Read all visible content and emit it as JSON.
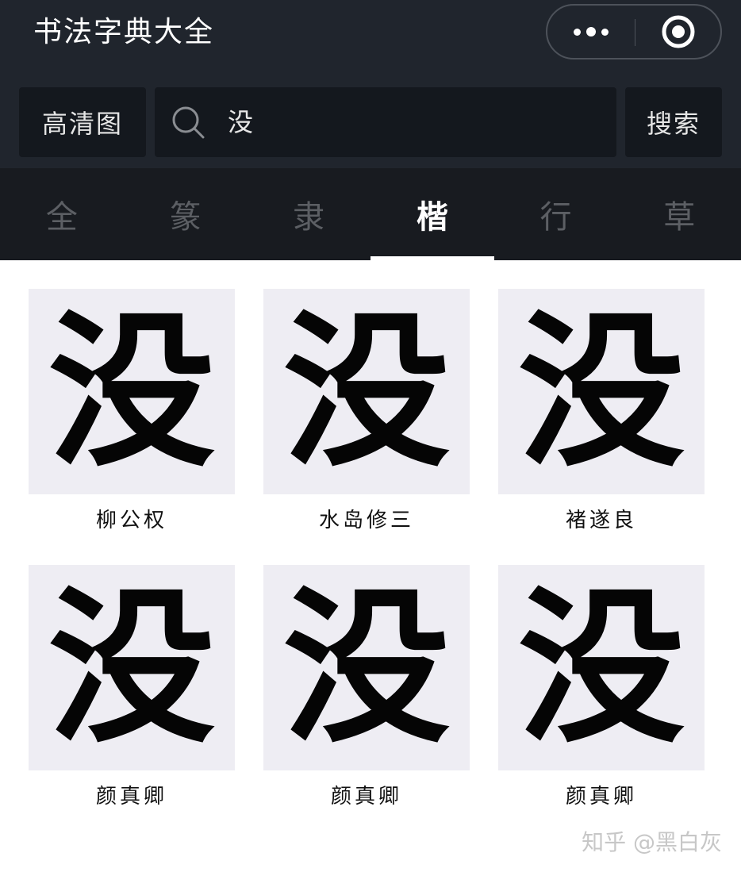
{
  "app": {
    "title": "书法字典大全"
  },
  "capsule": {
    "more_icon": "more-dots-icon",
    "close_icon": "target-close-icon"
  },
  "toolbar": {
    "hd_label": "高清图",
    "search_value": "没",
    "search_icon": "search-icon",
    "search_label": "搜索"
  },
  "tabs": [
    {
      "label": "全",
      "active": false
    },
    {
      "label": "篆",
      "active": false
    },
    {
      "label": "隶",
      "active": false
    },
    {
      "label": "楷",
      "active": true
    },
    {
      "label": "行",
      "active": false
    },
    {
      "label": "草",
      "active": false
    }
  ],
  "results": [
    {
      "glyph": "没",
      "author": "柳公权"
    },
    {
      "glyph": "没",
      "author": "水岛修三"
    },
    {
      "glyph": "没",
      "author": "褚遂良"
    },
    {
      "glyph": "没",
      "author": "颜真卿"
    },
    {
      "glyph": "没",
      "author": "颜真卿"
    },
    {
      "glyph": "没",
      "author": "颜真卿"
    }
  ],
  "watermark": "知乎 @黑白灰",
  "colors": {
    "header_bg": "#20252d",
    "tabs_bg": "#181b20",
    "control_bg": "#14181e",
    "card_bg": "#eeedf3",
    "active_tab": "#ffffff",
    "inactive_tab": "#5c5f64"
  }
}
